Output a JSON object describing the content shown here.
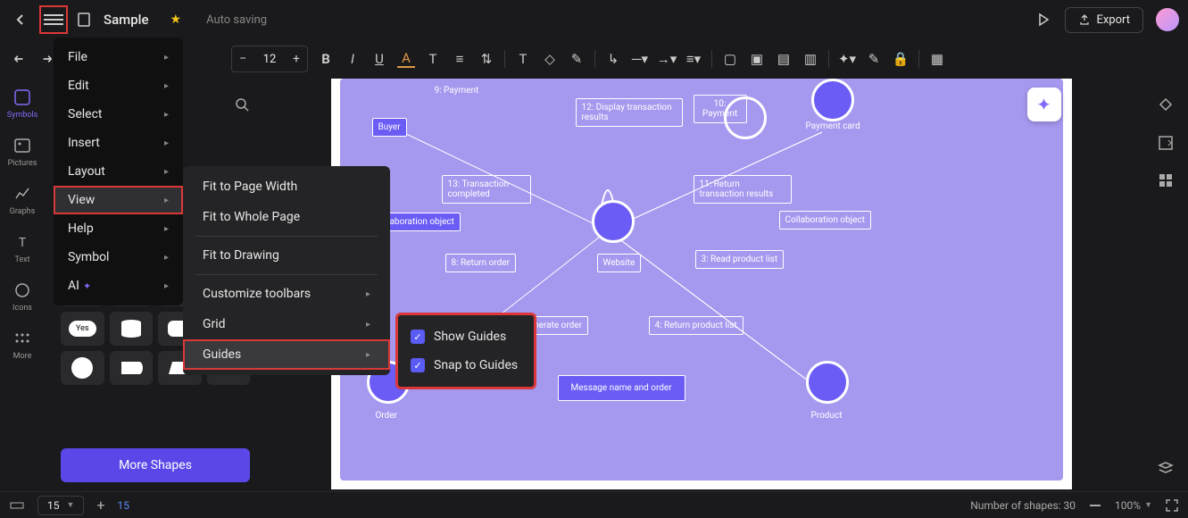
{
  "header": {
    "title": "Sample",
    "autosave": "Auto saving",
    "export": "Export"
  },
  "toolbar": {
    "font_size": "12"
  },
  "left_rail": {
    "items": [
      {
        "label": "Symbols"
      },
      {
        "label": "Pictures"
      },
      {
        "label": "Graphs"
      },
      {
        "label": "Text"
      },
      {
        "label": "Icons"
      },
      {
        "label": "More"
      }
    ]
  },
  "main_menu": {
    "items": [
      {
        "label": "File"
      },
      {
        "label": "Edit"
      },
      {
        "label": "Select"
      },
      {
        "label": "Insert"
      },
      {
        "label": "Layout"
      },
      {
        "label": "View"
      },
      {
        "label": "Help"
      },
      {
        "label": "Symbol"
      },
      {
        "label": "AI"
      }
    ]
  },
  "view_submenu": {
    "items": [
      {
        "label": "Fit to Page Width"
      },
      {
        "label": "Fit to Whole Page"
      },
      {
        "label": "Fit to Drawing"
      },
      {
        "label": "Customize toolbars"
      },
      {
        "label": "Grid"
      },
      {
        "label": "Guides"
      }
    ]
  },
  "guides_flyout": {
    "show_guides": "Show Guides",
    "snap_guides": "Snap to Guides"
  },
  "shapes_panel": {
    "more_shapes": "More Shapes",
    "yes_label": "Yes"
  },
  "canvas": {
    "nodes": {
      "buyer": "Buyer",
      "payment9": "9: Payment",
      "display12": "12: Display transaction results",
      "payment10": "10: Payment",
      "payment_card": "Payment card",
      "trans13": "13: Transaction completed",
      "collab1": "Collaboration object",
      "collab2": "Collaboration object",
      "return11": "11: Return transaction results",
      "return8": "8: Return order",
      "website": "Website",
      "read3": "3: Read product list",
      "gen7": "7: Generate order",
      "return4": "4: Return product list",
      "msg": "Message name and order",
      "order": "Order",
      "product": "Product"
    }
  },
  "statusbar": {
    "page_current": "15",
    "page_alt": "15",
    "shapes": "Number of shapes: 30",
    "zoom": "100%"
  }
}
